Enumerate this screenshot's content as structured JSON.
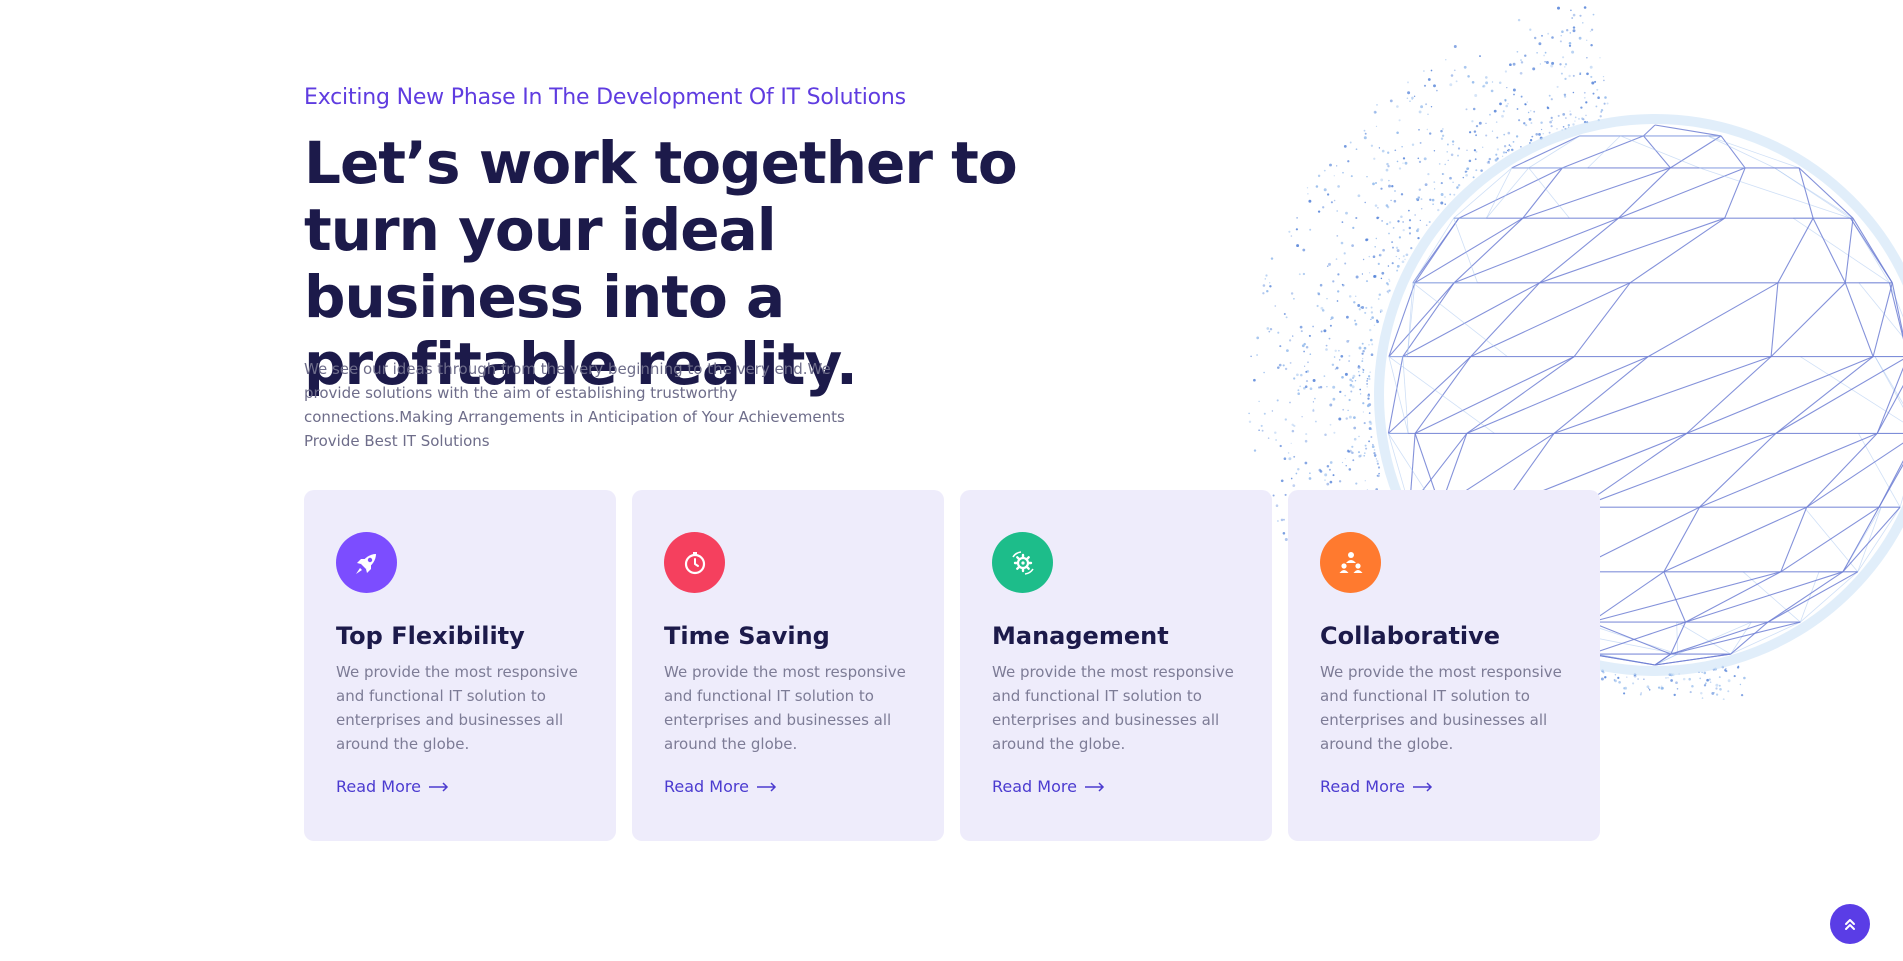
{
  "hero": {
    "eyebrow": "Exciting New Phase In The Development Of IT Solutions",
    "headline": "Let’s work together to turn your ideal business into a profitable reality.",
    "lead": "We see our ideas through from the very beginning to the very end.We provide solutions with the aim of establishing trustworthy connections.Making Arrangements in Anticipation of Your Achievements Provide Best IT Solutions"
  },
  "cards": [
    {
      "title": "Top Flexibility",
      "description": "We provide the most responsive and functional IT solution to enterprises and businesses all around the globe.",
      "link": "Read More",
      "icon": "rocket-icon",
      "icon_color": "#7c4dff"
    },
    {
      "title": "Time Saving",
      "description": "We provide the most responsive and functional IT solution to enterprises and businesses all around the globe.",
      "link": "Read More",
      "icon": "stopwatch-icon",
      "icon_color": "#f5405e"
    },
    {
      "title": "Management",
      "description": "We provide the most responsive and functional IT solution to enterprises and businesses all around the globe.",
      "link": "Read More",
      "icon": "gear-cycle-icon",
      "icon_color": "#1dbd8a"
    },
    {
      "title": "Collaborative",
      "description": "We provide the most responsive and functional IT solution to enterprises and businesses all around the globe.",
      "link": "Read More",
      "icon": "team-icon",
      "icon_color": "#ff7a2f"
    }
  ],
  "colors": {
    "accent": "#5f3ce0",
    "heading": "#1c1a4a",
    "card_background": "#eeecfb",
    "scroll_button": "#5a3de6"
  },
  "scroll_top": {
    "icon": "double-chevron-up-icon"
  }
}
